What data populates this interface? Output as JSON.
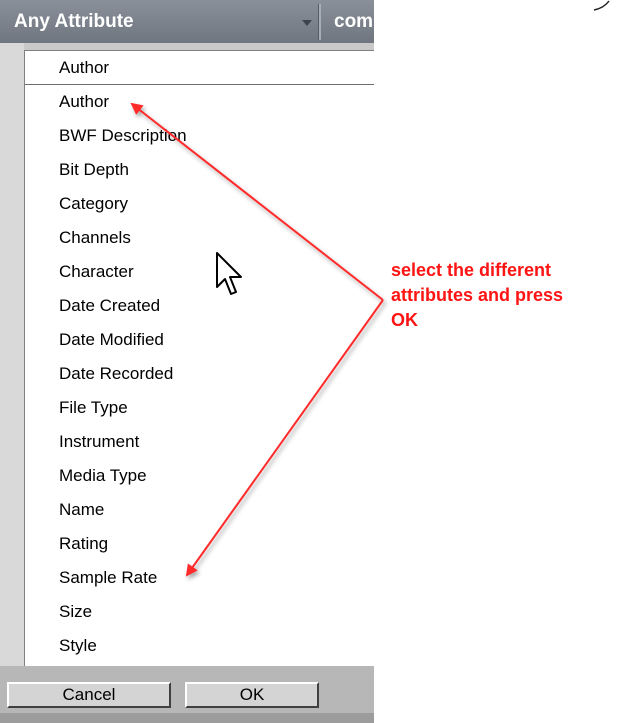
{
  "header": {
    "primary_label": "Any Attribute",
    "secondary_label": "com"
  },
  "list": {
    "items": [
      "Author",
      "Author",
      "BWF Description",
      "Bit Depth",
      "Category",
      "Channels",
      "Character",
      "Date Created",
      "Date Modified",
      "Date Recorded",
      "File Type",
      "Instrument",
      "Media Type",
      "Name",
      "Rating",
      "Sample Rate",
      "Size",
      "Style"
    ]
  },
  "buttons": {
    "cancel_label": "Cancel",
    "ok_label": "OK"
  },
  "annotation": {
    "lines": [
      "select the different",
      "attributes and press",
      "OK"
    ],
    "color": "#ff1414"
  },
  "colors": {
    "header_bg": "#7c828b",
    "panel_bg": "#c9c9c9",
    "arrow": "#ff2a2a"
  }
}
